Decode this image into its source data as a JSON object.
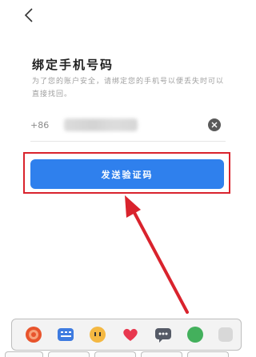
{
  "header": {
    "back_icon": "chevron-left-icon"
  },
  "main": {
    "title": "绑定手机号码",
    "description": "为了您的账户安全，请绑定您的手机号以便丢失时可以直接找回。",
    "phone": {
      "country_code": "+86",
      "value_obscured": true,
      "clear_icon": "clear-circle-icon"
    },
    "send_button_label": "发送验证码"
  },
  "annotation": {
    "highlight_color": "#d9232d",
    "arrow_color": "#d9232d"
  },
  "colors": {
    "primary": "#2f80ed",
    "title": "#1f1f1f",
    "muted": "#a0a0a0"
  },
  "emoji_bar": {
    "items": [
      "gear-sticker-icon",
      "keyboard-sticker-icon",
      "face-sticker-icon",
      "heart-sticker-icon",
      "chat-bubble-sticker-icon",
      "green-circle-sticker-icon",
      "partial-sticker-icon"
    ]
  }
}
